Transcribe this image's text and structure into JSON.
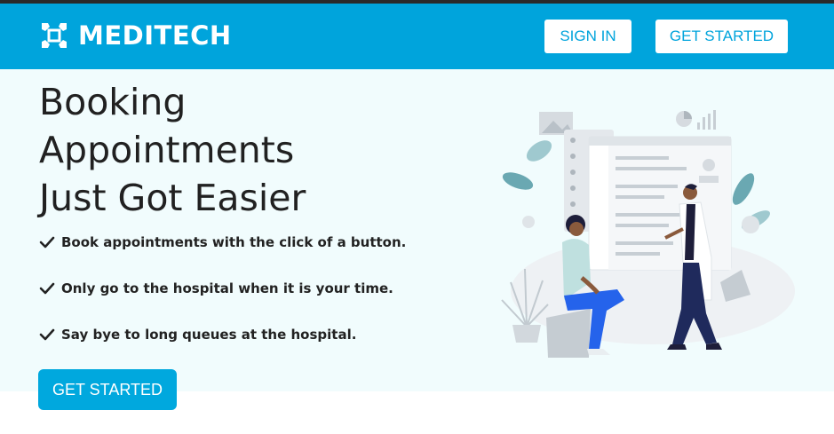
{
  "header": {
    "brand": "MEDITECH",
    "signin_label": "SIGN IN",
    "getstarted_label": "GET STARTED"
  },
  "hero": {
    "title_lines": [
      "Booking",
      "Appointments",
      "Just Got Easier"
    ],
    "features": [
      "Book appointments with the click of a button.",
      "Only go to the hospital when it is your time.",
      "Say bye to long queues at the hospital."
    ],
    "cta_label": "GET STARTED"
  },
  "colors": {
    "primary": "#00a4dc",
    "hero_bg": "#f1fcfd",
    "text": "#212121"
  }
}
